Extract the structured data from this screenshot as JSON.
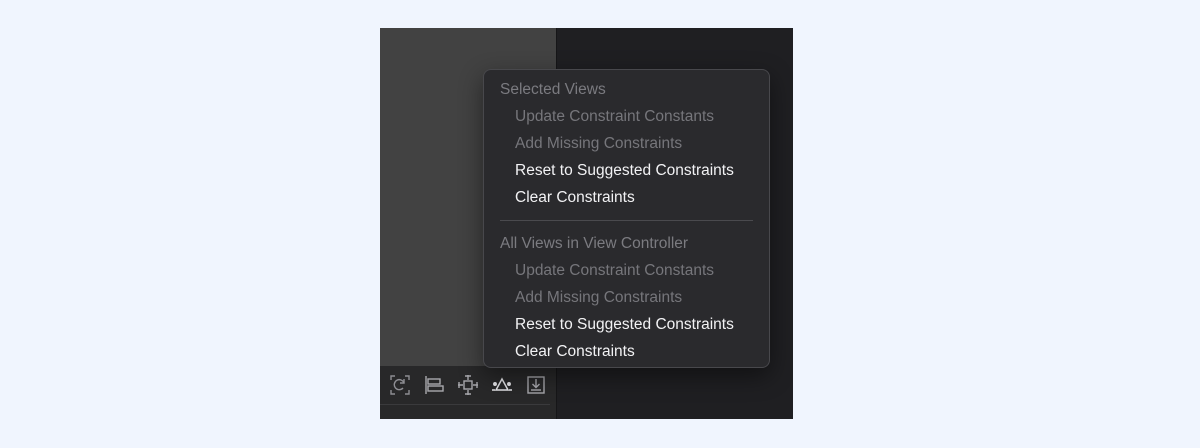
{
  "toolbar": {
    "icons": [
      {
        "name": "update-frames-icon"
      },
      {
        "name": "align-icon"
      },
      {
        "name": "add-constraints-icon"
      },
      {
        "name": "resolve-autolayout-issues-icon"
      },
      {
        "name": "embed-in-icon"
      }
    ]
  },
  "menu": {
    "selected_views": {
      "header": "Selected Views",
      "items": [
        {
          "label": "Update Constraint Constants",
          "enabled": false
        },
        {
          "label": "Add Missing Constraints",
          "enabled": false
        },
        {
          "label": "Reset to Suggested Constraints",
          "enabled": true
        },
        {
          "label": "Clear Constraints",
          "enabled": true
        }
      ]
    },
    "all_views": {
      "header": "All Views in View Controller",
      "items": [
        {
          "label": "Update Constraint Constants",
          "enabled": false
        },
        {
          "label": "Add Missing Constraints",
          "enabled": false
        },
        {
          "label": "Reset to Suggested Constraints",
          "enabled": true
        },
        {
          "label": "Clear Constraints",
          "enabled": true
        }
      ]
    }
  },
  "colors": {
    "canvas": "#424242",
    "menu_background": "#2a2a2d",
    "enabled_text": "#f2f2f4",
    "disabled_text": "#76767b"
  }
}
